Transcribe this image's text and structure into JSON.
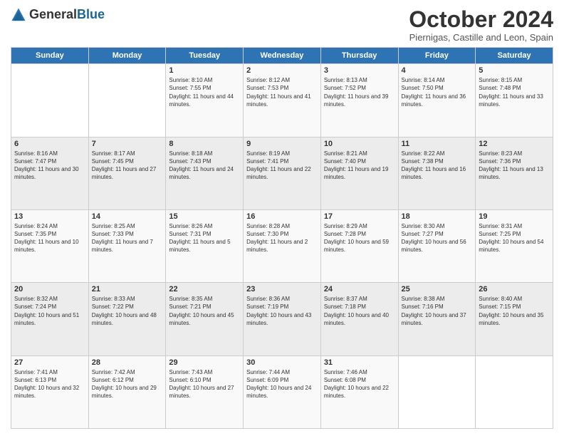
{
  "logo": {
    "general": "General",
    "blue": "Blue"
  },
  "header": {
    "month": "October 2024",
    "location": "Piernigas, Castille and Leon, Spain"
  },
  "weekdays": [
    "Sunday",
    "Monday",
    "Tuesday",
    "Wednesday",
    "Thursday",
    "Friday",
    "Saturday"
  ],
  "weeks": [
    [
      {
        "day": "",
        "info": ""
      },
      {
        "day": "",
        "info": ""
      },
      {
        "day": "1",
        "info": "Sunrise: 8:10 AM\nSunset: 7:55 PM\nDaylight: 11 hours and 44 minutes."
      },
      {
        "day": "2",
        "info": "Sunrise: 8:12 AM\nSunset: 7:53 PM\nDaylight: 11 hours and 41 minutes."
      },
      {
        "day": "3",
        "info": "Sunrise: 8:13 AM\nSunset: 7:52 PM\nDaylight: 11 hours and 39 minutes."
      },
      {
        "day": "4",
        "info": "Sunrise: 8:14 AM\nSunset: 7:50 PM\nDaylight: 11 hours and 36 minutes."
      },
      {
        "day": "5",
        "info": "Sunrise: 8:15 AM\nSunset: 7:48 PM\nDaylight: 11 hours and 33 minutes."
      }
    ],
    [
      {
        "day": "6",
        "info": "Sunrise: 8:16 AM\nSunset: 7:47 PM\nDaylight: 11 hours and 30 minutes."
      },
      {
        "day": "7",
        "info": "Sunrise: 8:17 AM\nSunset: 7:45 PM\nDaylight: 11 hours and 27 minutes."
      },
      {
        "day": "8",
        "info": "Sunrise: 8:18 AM\nSunset: 7:43 PM\nDaylight: 11 hours and 24 minutes."
      },
      {
        "day": "9",
        "info": "Sunrise: 8:19 AM\nSunset: 7:41 PM\nDaylight: 11 hours and 22 minutes."
      },
      {
        "day": "10",
        "info": "Sunrise: 8:21 AM\nSunset: 7:40 PM\nDaylight: 11 hours and 19 minutes."
      },
      {
        "day": "11",
        "info": "Sunrise: 8:22 AM\nSunset: 7:38 PM\nDaylight: 11 hours and 16 minutes."
      },
      {
        "day": "12",
        "info": "Sunrise: 8:23 AM\nSunset: 7:36 PM\nDaylight: 11 hours and 13 minutes."
      }
    ],
    [
      {
        "day": "13",
        "info": "Sunrise: 8:24 AM\nSunset: 7:35 PM\nDaylight: 11 hours and 10 minutes."
      },
      {
        "day": "14",
        "info": "Sunrise: 8:25 AM\nSunset: 7:33 PM\nDaylight: 11 hours and 7 minutes."
      },
      {
        "day": "15",
        "info": "Sunrise: 8:26 AM\nSunset: 7:31 PM\nDaylight: 11 hours and 5 minutes."
      },
      {
        "day": "16",
        "info": "Sunrise: 8:28 AM\nSunset: 7:30 PM\nDaylight: 11 hours and 2 minutes."
      },
      {
        "day": "17",
        "info": "Sunrise: 8:29 AM\nSunset: 7:28 PM\nDaylight: 10 hours and 59 minutes."
      },
      {
        "day": "18",
        "info": "Sunrise: 8:30 AM\nSunset: 7:27 PM\nDaylight: 10 hours and 56 minutes."
      },
      {
        "day": "19",
        "info": "Sunrise: 8:31 AM\nSunset: 7:25 PM\nDaylight: 10 hours and 54 minutes."
      }
    ],
    [
      {
        "day": "20",
        "info": "Sunrise: 8:32 AM\nSunset: 7:24 PM\nDaylight: 10 hours and 51 minutes."
      },
      {
        "day": "21",
        "info": "Sunrise: 8:33 AM\nSunset: 7:22 PM\nDaylight: 10 hours and 48 minutes."
      },
      {
        "day": "22",
        "info": "Sunrise: 8:35 AM\nSunset: 7:21 PM\nDaylight: 10 hours and 45 minutes."
      },
      {
        "day": "23",
        "info": "Sunrise: 8:36 AM\nSunset: 7:19 PM\nDaylight: 10 hours and 43 minutes."
      },
      {
        "day": "24",
        "info": "Sunrise: 8:37 AM\nSunset: 7:18 PM\nDaylight: 10 hours and 40 minutes."
      },
      {
        "day": "25",
        "info": "Sunrise: 8:38 AM\nSunset: 7:16 PM\nDaylight: 10 hours and 37 minutes."
      },
      {
        "day": "26",
        "info": "Sunrise: 8:40 AM\nSunset: 7:15 PM\nDaylight: 10 hours and 35 minutes."
      }
    ],
    [
      {
        "day": "27",
        "info": "Sunrise: 7:41 AM\nSunset: 6:13 PM\nDaylight: 10 hours and 32 minutes."
      },
      {
        "day": "28",
        "info": "Sunrise: 7:42 AM\nSunset: 6:12 PM\nDaylight: 10 hours and 29 minutes."
      },
      {
        "day": "29",
        "info": "Sunrise: 7:43 AM\nSunset: 6:10 PM\nDaylight: 10 hours and 27 minutes."
      },
      {
        "day": "30",
        "info": "Sunrise: 7:44 AM\nSunset: 6:09 PM\nDaylight: 10 hours and 24 minutes."
      },
      {
        "day": "31",
        "info": "Sunrise: 7:46 AM\nSunset: 6:08 PM\nDaylight: 10 hours and 22 minutes."
      },
      {
        "day": "",
        "info": ""
      },
      {
        "day": "",
        "info": ""
      }
    ]
  ]
}
